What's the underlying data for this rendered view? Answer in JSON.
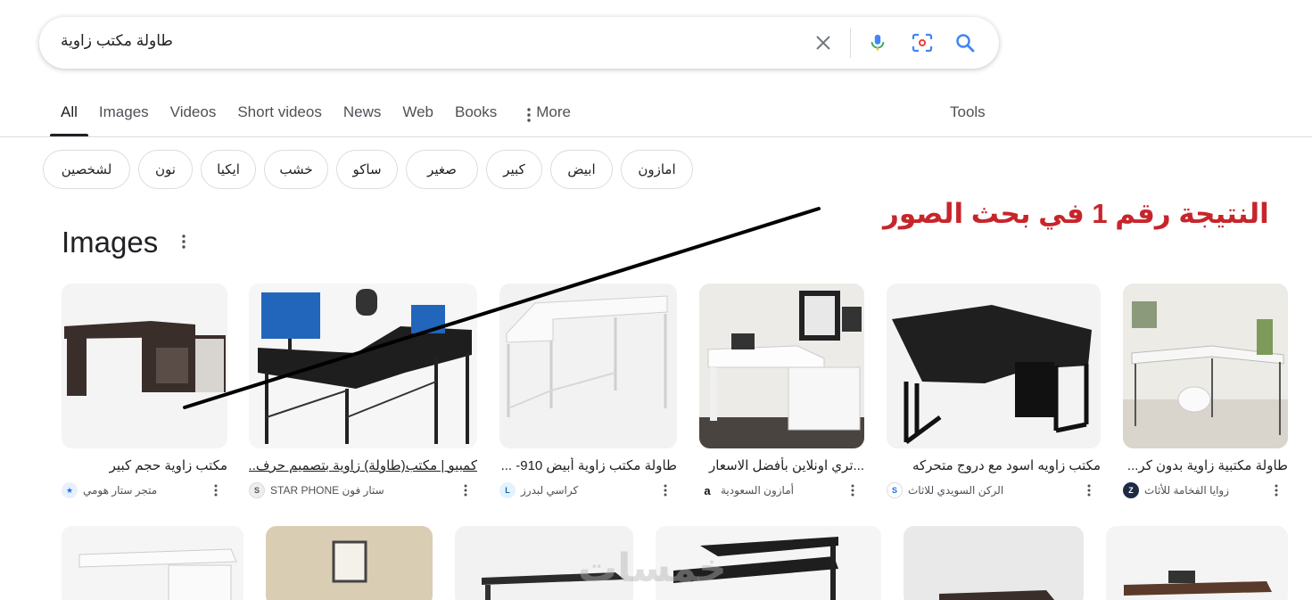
{
  "search": {
    "query": "طاولة مكتب زاوية",
    "icons": [
      "close-icon",
      "mic-icon",
      "lens-icon",
      "search-icon"
    ]
  },
  "tabs": [
    {
      "label": "All",
      "active": true
    },
    {
      "label": "Images"
    },
    {
      "label": "Videos"
    },
    {
      "label": "Short videos"
    },
    {
      "label": "News"
    },
    {
      "label": "Web"
    },
    {
      "label": "Books"
    },
    {
      "label": "More",
      "icon": "more-vert-icon"
    }
  ],
  "tools_label": "Tools",
  "chips": [
    "لشخصين",
    "نون",
    "ايكيا",
    "خشب",
    "ساكو",
    "صغير",
    "كبير",
    "ابيض",
    "امازون"
  ],
  "annotation": {
    "text": "النتيجة رقم 1 في بحث الصور",
    "color": "#c7252b"
  },
  "images_section": {
    "heading": "Images",
    "cards": [
      {
        "title": "مكتب زاوية حجم كبير",
        "source": "متجر ستار هومي",
        "logo": "star-home-logo"
      },
      {
        "title": "كمبيو | مكتب(طاولة) زاوية بتصميم حرف...",
        "source": "ستار فون STAR PHONE",
        "logo": "star-phone-logo"
      },
      {
        "title": "طاولة مكتب زاوية أبيض 910- ...",
        "source": "كراسي لبدرز",
        "logo": "leaders-logo"
      },
      {
        "title": "...تري اونلاين بأفضل الاسعار",
        "source": "أمازون السعودية",
        "logo": "amazon-logo"
      },
      {
        "title": "مكتب زاويه اسود مع دروج متحركه",
        "source": "الركن السويدي للاثاث",
        "logo": "swedish-corner-logo"
      },
      {
        "title": "طاولة مكتبية زاوية بدون كر...",
        "source": "زوايا الفخامة للأثاث",
        "logo": "zawaya-logo"
      }
    ]
  },
  "watermark": "خمسات"
}
